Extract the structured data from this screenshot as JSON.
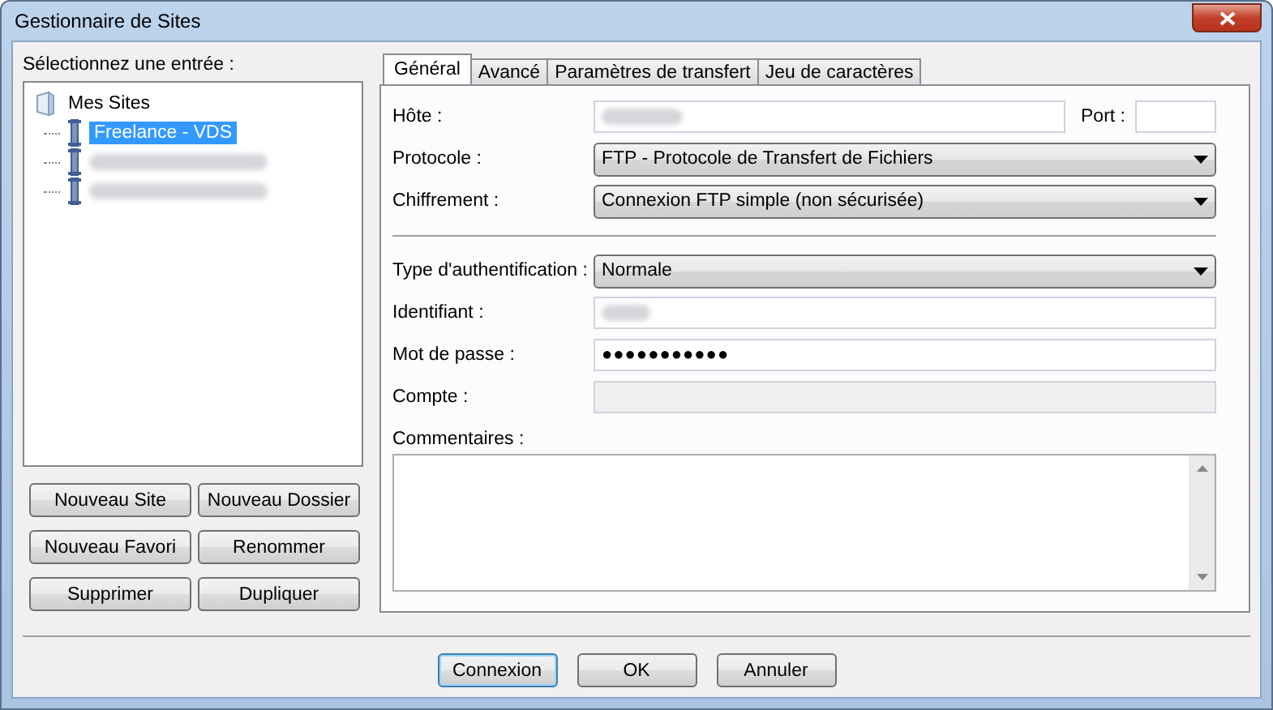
{
  "window": {
    "title": "Gestionnaire de Sites"
  },
  "site_tree": {
    "label": "Sélectionnez une entrée :",
    "root": {
      "label": "Mes Sites",
      "children": [
        {
          "kind": "site",
          "label": "Freelance - VDS",
          "selected": true
        },
        {
          "kind": "redacted",
          "selected": false
        },
        {
          "kind": "redacted",
          "selected": false
        }
      ]
    }
  },
  "site_buttons": [
    {
      "label": "Nouveau Site"
    },
    {
      "label": "Nouveau Dossier"
    },
    {
      "label": "Nouveau Favori"
    },
    {
      "label": "Renommer"
    },
    {
      "label": "Supprimer"
    },
    {
      "label": "Dupliquer"
    }
  ],
  "tabs": [
    {
      "label": "Général",
      "selected": true
    },
    {
      "label": "Avancé",
      "selected": false
    },
    {
      "label": "Paramètres de transfert",
      "selected": false
    },
    {
      "label": "Jeu de caractères",
      "selected": false
    }
  ],
  "form": {
    "host": {
      "label": "Hôte :",
      "redacted": true
    },
    "port": {
      "label": "Port :"
    },
    "protocol": {
      "label": "Protocole :",
      "value": "FTP - Protocole de Transfert de Fichiers"
    },
    "encryption": {
      "label": "Chiffrement :",
      "value": "Connexion FTP simple (non sécurisée)"
    },
    "auth_type": {
      "label": "Type d'authentification :",
      "value": "Normale"
    },
    "user": {
      "label": "Identifiant :",
      "redacted": true
    },
    "password": {
      "label": "Mot de passe :",
      "value": "●●●●●●●●●●●"
    },
    "account": {
      "label": "Compte :",
      "disabled": true
    },
    "comments": {
      "label": "Commentaires :"
    }
  },
  "buttons": [
    {
      "label": "Connexion",
      "default": true
    },
    {
      "label": "OK",
      "default": false
    },
    {
      "label": "Annuler",
      "default": false
    }
  ]
}
